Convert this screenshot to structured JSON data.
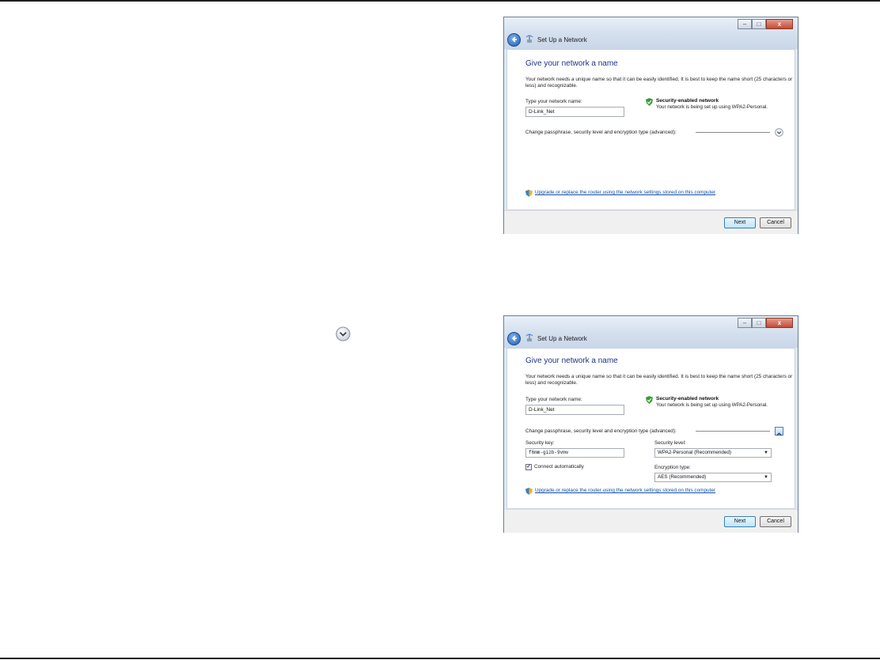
{
  "dialog": {
    "title": "Set Up a Network",
    "heading": "Give your network a name",
    "description": "Your network needs a unique name so that it can be easily identified. It is best to keep the name short (25 characters or less) and recognizable.",
    "name_label": "Type your network name:",
    "name_value": "D-Link_Net",
    "security_title": "Security-enabled network",
    "security_subtitle": "Your network is being set up using WPA2-Personal.",
    "advanced_label": "Change passphrase, security level and encryption type (advanced):",
    "upgrade_link": "Upgrade or replace the router using the network settings stored on this computer",
    "next_label": "Next",
    "cancel_label": "Cancel",
    "window_controls": {
      "minimize": "–",
      "maximize": "□",
      "close": "x"
    }
  },
  "advanced": {
    "security_key_label": "Security key:",
    "security_key_value": "f6mm-gizb-9vmv",
    "security_level_label": "Security level:",
    "security_level_value": "WPA2-Personal (Recommended)",
    "connect_label": "Connect automatically",
    "connect_checked": true,
    "encryption_label": "Encryption type:",
    "encryption_value": "AES (Recommended)"
  },
  "icons": {
    "back": "back-arrow-icon",
    "wizard": "network-wizard-icon",
    "shield": "green-shield-check-icon",
    "expand": "chevron-down-circle-icon",
    "collapse": "chevron-up-icon",
    "upgrade": "uac-shield-icon"
  },
  "colors": {
    "heading": "#1e3287",
    "link": "#0f4ea8",
    "shield": "#3a9a3a",
    "close_button": "#c44a35"
  }
}
